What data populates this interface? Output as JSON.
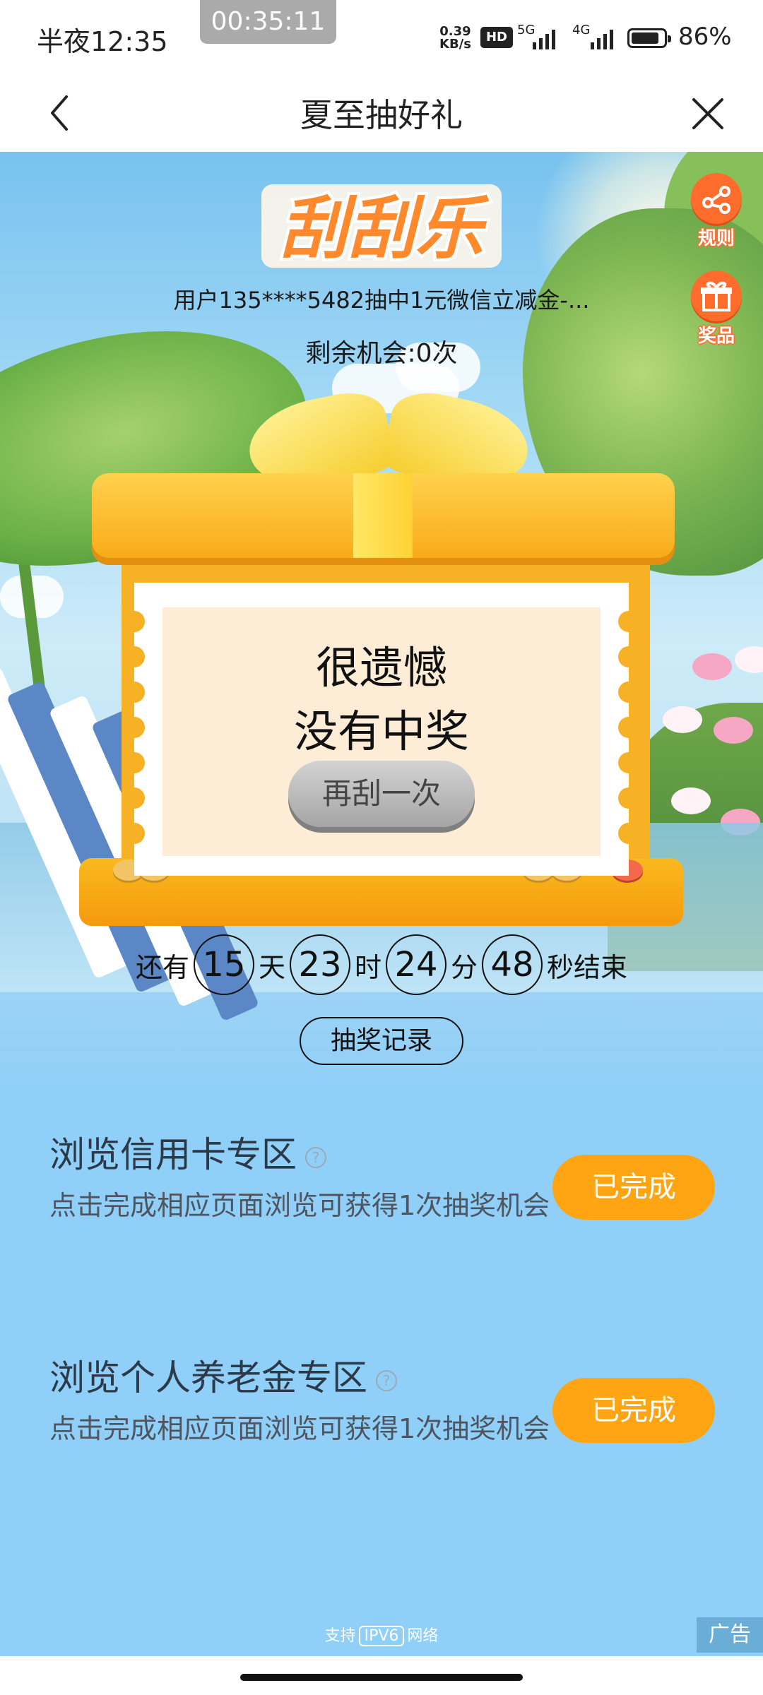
{
  "status_bar": {
    "time": "半夜12:35",
    "recording_timer": "00:35:11",
    "net_speed_value": "0.39",
    "net_speed_unit": "KB/s",
    "hd_badge": "HD",
    "signal_1_gen": "5G",
    "signal_2_gen": "4G",
    "battery_level": 0.86,
    "battery_text": "86%"
  },
  "nav": {
    "title": "夏至抽好礼",
    "back_icon": "chevron-left-icon",
    "close_icon": "close-icon"
  },
  "hero": {
    "logo_text": "刮刮乐",
    "ticker": "用户135****5482抽中1元微信立减金-...",
    "chances": "剩余机会:0次",
    "side_buttons": [
      {
        "label": "规则",
        "icon": "share-icon"
      },
      {
        "label": "奖品",
        "icon": "gift-icon"
      }
    ],
    "result_line_1": "很遗憾",
    "result_line_2": "没有中奖",
    "retry_label": "再刮一次",
    "countdown": {
      "prefix": "还有",
      "days": "15",
      "days_unit": "天",
      "hours": "23",
      "hours_unit": "时",
      "minutes": "24",
      "minutes_unit": "分",
      "seconds": "48",
      "seconds_suffix": "秒结束"
    },
    "record_label": "抽奖记录"
  },
  "tasks": [
    {
      "title": "浏览信用卡专区",
      "help_icon": "question-circle-icon",
      "desc": "点击完成相应页面浏览可获得1次抽奖机会",
      "button": "已完成"
    },
    {
      "title": "浏览个人养老金专区",
      "help_icon": "question-circle-icon",
      "desc": "点击完成相应页面浏览可获得1次抽奖机会",
      "button": "已完成"
    }
  ],
  "footer": {
    "ipv6_prefix": "支持",
    "ipv6_label": "IPV6",
    "ipv6_suffix": "网络",
    "ad_label": "广告"
  },
  "colors": {
    "accent_orange": "#ffa514",
    "side_button": "#ff6d2d",
    "gift_yellow": "#f7b125",
    "task_background": "#8fcff8",
    "ticket_inner": "#fdecd6"
  }
}
